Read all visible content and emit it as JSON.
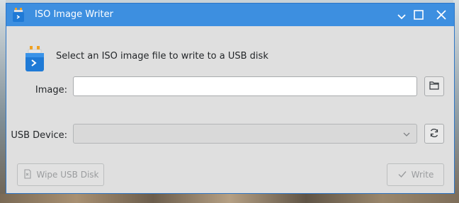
{
  "window": {
    "title": "ISO Image Writer"
  },
  "header": {
    "instruction": "Select an ISO image file to write to a USB disk"
  },
  "form": {
    "image_label": "Image:",
    "image_value": "",
    "usb_label": "USB Device:",
    "usb_selected": ""
  },
  "buttons": {
    "wipe_label": "Wipe USB Disk",
    "write_label": "Write"
  },
  "icons": {
    "app": "usb-drive-icon",
    "browse": "folder-icon",
    "refresh": "refresh-icon",
    "dropdown": "chevron-down-icon",
    "wipe": "erase-disk-icon",
    "write": "checkmark-icon"
  },
  "colors": {
    "titlebar": "#3d8fe0",
    "window_bg": "#dfdfdf",
    "disabled_text": "#9a9c9e"
  }
}
